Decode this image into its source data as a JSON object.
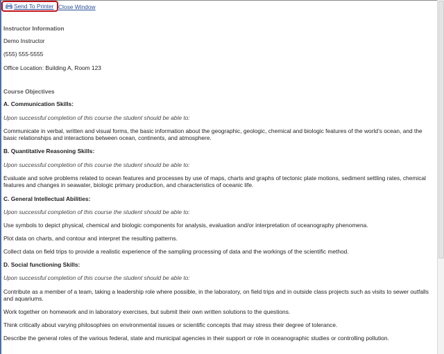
{
  "toolbar": {
    "print_label": "Send To Printer",
    "close_label": "Close Window"
  },
  "instructor": {
    "heading": "Instructor Information",
    "name": "Demo Instructor",
    "phone": "(555) 555-5555",
    "office": "Office Location: Building A, Room 123"
  },
  "objectives": {
    "heading": "Course Objectives",
    "intro": "Upon successful completion of this course the student should be able to:",
    "a": {
      "title": "A.  Communication Skills:",
      "items": [
        "Communicate in verbal, written and visual forms, the basic information about the geographic, geologic, chemical and biologic features of the world’s ocean, and the basic relationships and interactions between ocean, continents, and atmosphere."
      ]
    },
    "b": {
      "title": "B.  Quantitative Reasoning Skills:",
      "items": [
        "Evaluate and solve problems related to ocean features and processes by use of maps, charts and graphs of tectonic plate motions, sediment settling rates, chemical features and changes in seawater, biologic primary production, and characteristics of oceanic life."
      ]
    },
    "c": {
      "title": "C.  General Intellectual Abilities:",
      "items": [
        "Use symbols to depict physical, chemical and biologic components for analysis, evaluation and/or interpretation of oceanography phenomena.",
        "Plot data on charts, and contour and interpret the resulting patterns.",
        "Collect data on field trips to provide a realistic experience of the sampling processing of data and the workings of the scientific method."
      ]
    },
    "d": {
      "title": "D.  Social functioning Skills:",
      "items": [
        "Contribute as a member of a team, taking a leadership role where possible, in the laboratory, on field trips and in outside class projects such as visits to sewer outfalls and aquariums.",
        "Work together on homework and in laboratory exercises, but submit their own written solutions to the questions.",
        "Think critically about varying philosophies on environmental issues or scientific concepts that may stress their degree of tolerance.",
        "Describe the general roles of the various federal, state and municipal agencies in their support or role in oceanographic studies or controlling pollution."
      ]
    }
  }
}
